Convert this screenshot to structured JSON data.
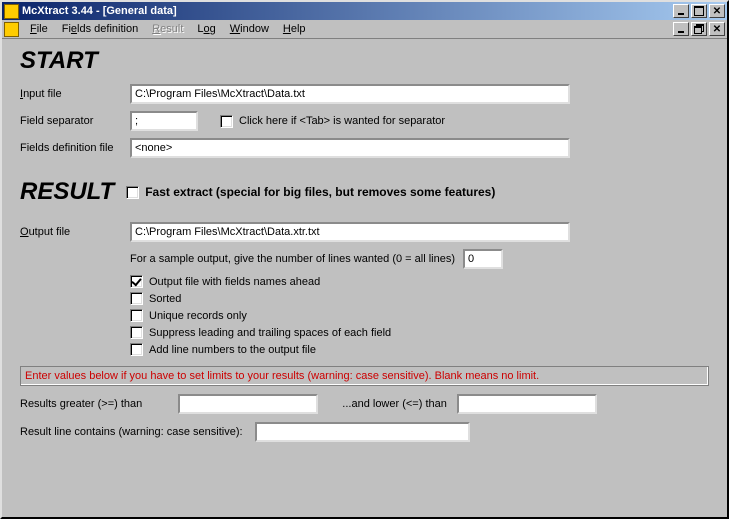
{
  "window": {
    "title": "McXtract 3.44 - [General data]"
  },
  "menu": {
    "file": "File",
    "fields_def": "Fields definition",
    "result": "Result",
    "log": "Log",
    "window": "Window",
    "help": "Help"
  },
  "start": {
    "heading": "START",
    "input_file_label": "Input file",
    "input_file_value": "C:\\Program Files\\McXtract\\Data.txt",
    "field_sep_label": "Field separator",
    "field_sep_value": ";",
    "tab_sep_label": "Click here if <Tab> is wanted for separator",
    "fields_def_file_label": "Fields definition file",
    "fields_def_file_value": "<none>"
  },
  "result": {
    "heading": "RESULT",
    "fast_extract_label": "Fast extract (special for big files, but removes some features)",
    "output_file_label": "Output file",
    "output_file_value": "C:\\Program Files\\McXtract\\Data.xtr.txt",
    "sample_lines_label": "For a sample output, give the number of lines wanted (0 = all lines)",
    "sample_lines_value": "0",
    "opt_fields_names": "Output file with fields  names ahead",
    "opt_sorted": "Sorted",
    "opt_unique": "Unique records only",
    "opt_suppress_spaces": "Suppress leading and trailing spaces of each field",
    "opt_add_line_numbers": "Add line numbers to the output file",
    "warning_text": "Enter values below if you have to set limits to your results (warning: case sensitive). Blank means no limit.",
    "greater_label": "Results greater (>=) than",
    "lower_label": "...and lower (<=) than",
    "contains_label": "Result line contains (warning: case sensitive):"
  }
}
